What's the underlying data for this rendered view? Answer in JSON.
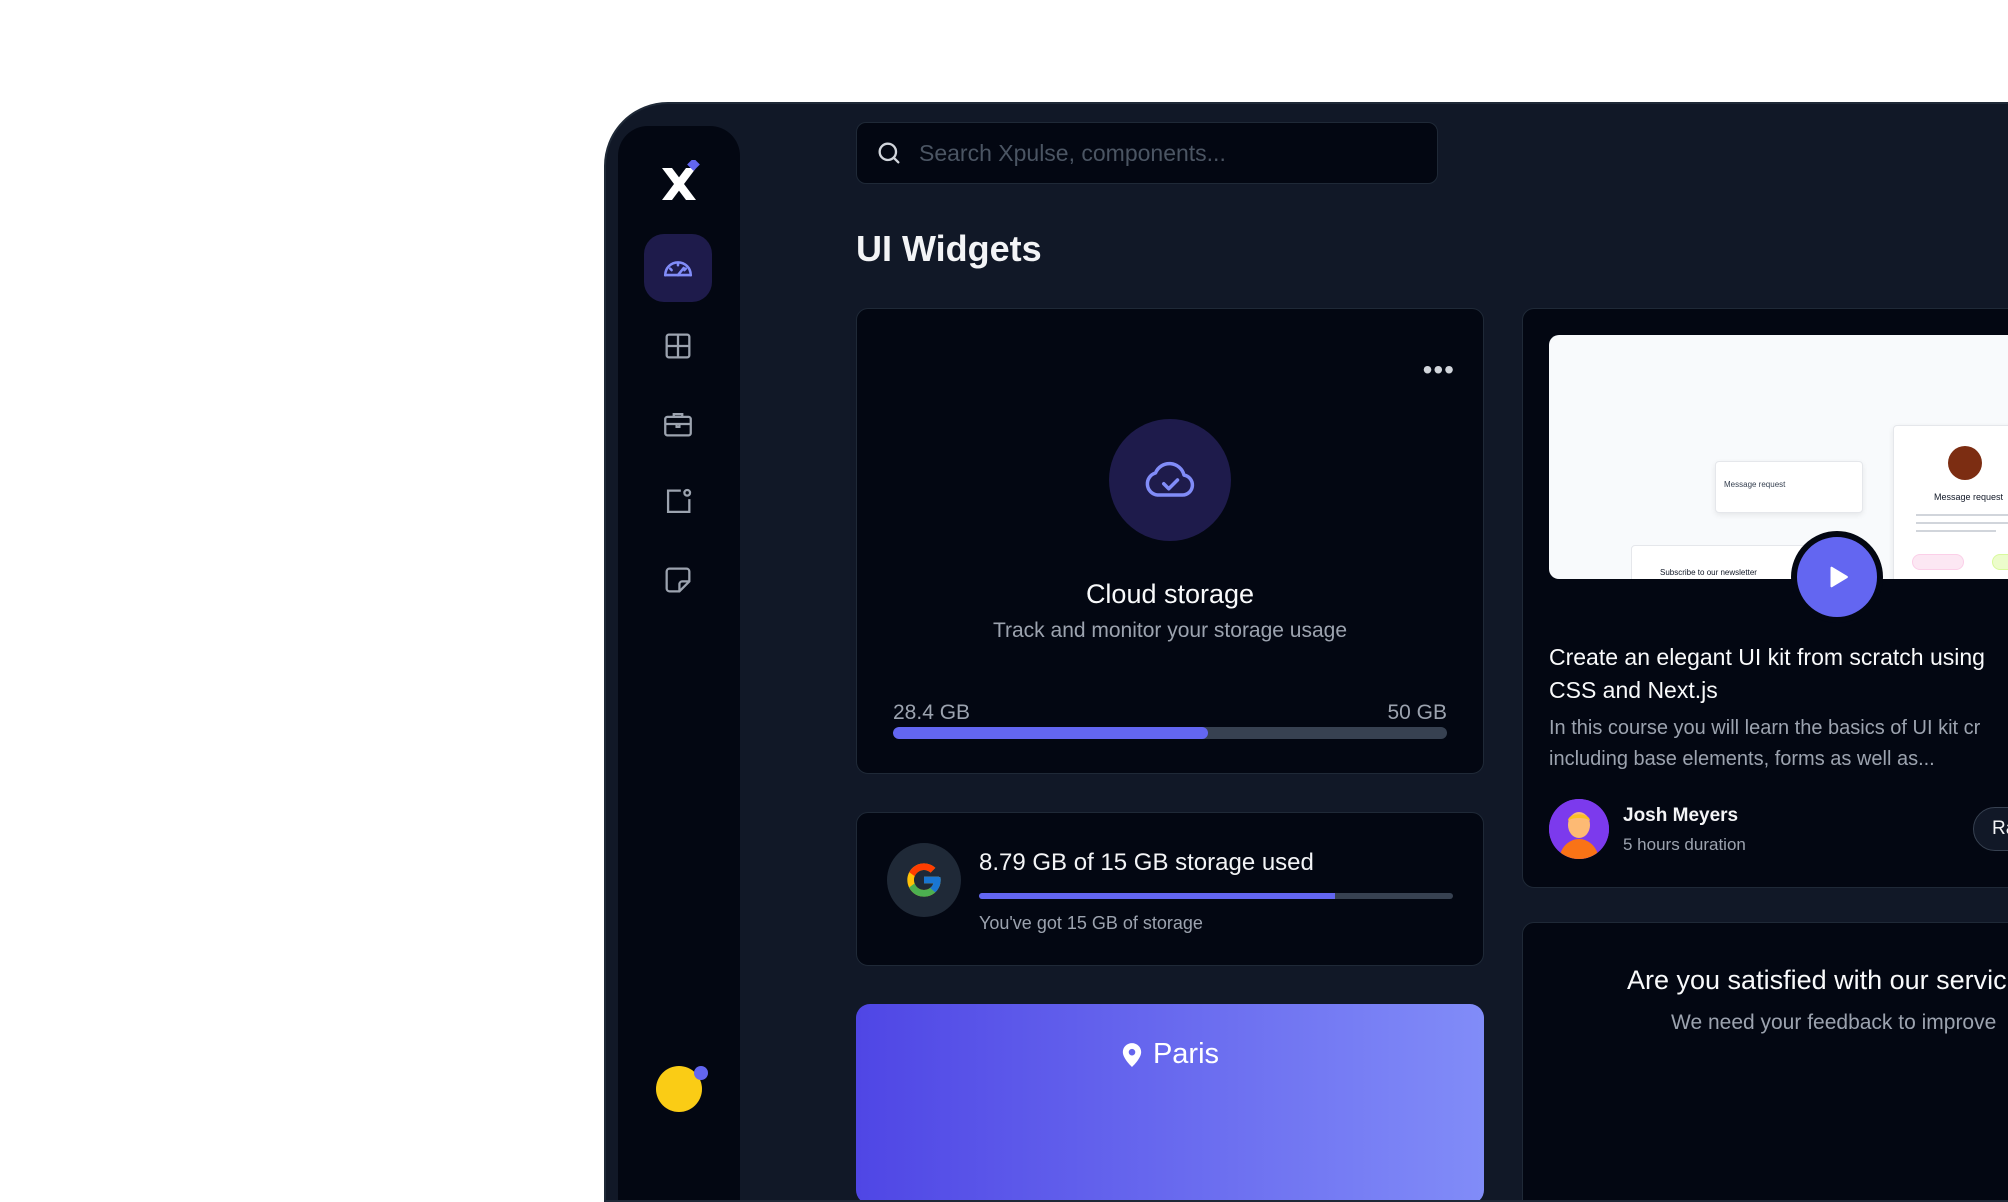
{
  "search": {
    "placeholder": "Search Xpulse, components..."
  },
  "page": {
    "title": "UI Widgets"
  },
  "sidebar": {
    "items": [
      {
        "icon": "gauge-icon",
        "active": true
      },
      {
        "icon": "grid-icon",
        "active": false
      },
      {
        "icon": "briefcase-icon",
        "active": false
      },
      {
        "icon": "notification-square-icon",
        "active": false
      },
      {
        "icon": "sticky-note-icon",
        "active": false
      }
    ]
  },
  "cloud_storage": {
    "menu": "•••",
    "title": "Cloud storage",
    "subtitle": "Track and monitor your storage usage",
    "used": "28.4 GB",
    "total": "50 GB",
    "progress": 0.568
  },
  "google_storage": {
    "title": "8.79 GB of 15 GB storage used",
    "subtitle": "You've got 15 GB of storage",
    "progress": 0.75
  },
  "weather": {
    "city": "Paris"
  },
  "course": {
    "thumb": {
      "mock_request": "Message request",
      "mock_title": "Message request",
      "mock_newsletter": "Subscribe to our newsletter"
    },
    "title_line1": "Create an elegant UI kit from scratch using",
    "title_line2": "CSS and Next.js",
    "desc_line1": "In this course you will learn the basics of UI kit cr",
    "desc_line2": "including base elements, forms as well as...",
    "author": "Josh Meyers",
    "duration": "5 hours duration",
    "rate_label": "Ra"
  },
  "feedback": {
    "title": "Are you satisfied with our servic",
    "subtitle": "We need your feedback to improve"
  },
  "colors": {
    "accent": "#6366f1",
    "surface": "#030712",
    "background": "#111827"
  }
}
